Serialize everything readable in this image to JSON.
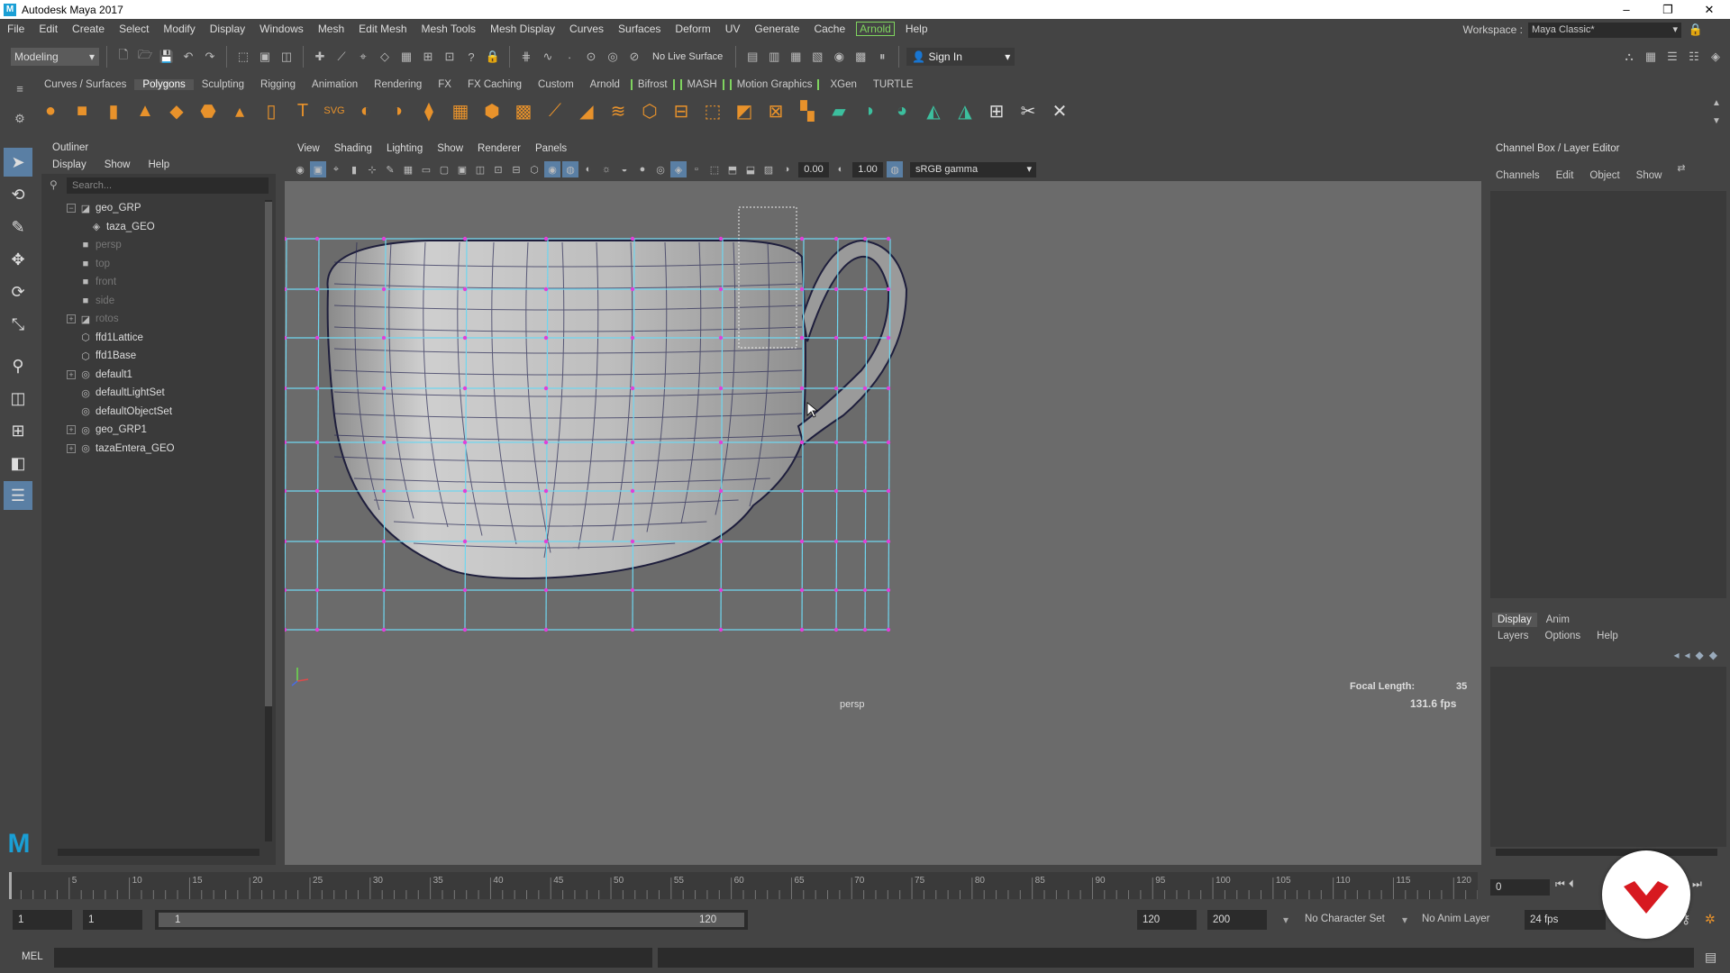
{
  "window": {
    "title": "Autodesk Maya 2017",
    "controls": [
      "–",
      "❐",
      "✕"
    ]
  },
  "menubar": {
    "items": [
      "File",
      "Edit",
      "Create",
      "Select",
      "Modify",
      "Display",
      "Windows",
      "Mesh",
      "Edit Mesh",
      "Mesh Tools",
      "Mesh Display",
      "Curves",
      "Surfaces",
      "Deform",
      "UV",
      "Generate",
      "Cache",
      "Arnold",
      "Help"
    ],
    "workspace_label": "Workspace :",
    "workspace_value": "Maya Classic*"
  },
  "statusline": {
    "mode": "Modeling",
    "live_surface": "No Live Surface",
    "sign_in": "Sign In"
  },
  "shelf": {
    "tabs": [
      "Curves / Surfaces",
      "Polygons",
      "Sculpting",
      "Rigging",
      "Animation",
      "Rendering",
      "FX",
      "FX Caching",
      "Custom",
      "Arnold",
      "Bifrost",
      "MASH",
      "Motion Graphics",
      "XGen",
      "TURTLE"
    ],
    "active_tab": "Polygons"
  },
  "outliner": {
    "title": "Outliner",
    "menu": [
      "Display",
      "Show",
      "Help"
    ],
    "search_placeholder": "Search...",
    "items": [
      {
        "label": "geo_GRP",
        "expander": "−",
        "indent": 0,
        "dim": false,
        "icon": "group-icon"
      },
      {
        "label": "taza_GEO",
        "expander": "",
        "indent": 1,
        "dim": false,
        "icon": "mesh-icon"
      },
      {
        "label": "persp",
        "expander": "",
        "indent": 0,
        "dim": true,
        "icon": "camera-icon"
      },
      {
        "label": "top",
        "expander": "",
        "indent": 0,
        "dim": true,
        "icon": "camera-icon"
      },
      {
        "label": "front",
        "expander": "",
        "indent": 0,
        "dim": true,
        "icon": "camera-icon"
      },
      {
        "label": "side",
        "expander": "",
        "indent": 0,
        "dim": true,
        "icon": "camera-icon"
      },
      {
        "label": "rotos",
        "expander": "+",
        "indent": 0,
        "dim": true,
        "icon": "group-icon"
      },
      {
        "label": "ffd1Lattice",
        "expander": "",
        "indent": 0,
        "dim": false,
        "icon": "lattice-icon"
      },
      {
        "label": "ffd1Base",
        "expander": "",
        "indent": 0,
        "dim": false,
        "icon": "lattice-icon"
      },
      {
        "label": "default1",
        "expander": "+",
        "indent": 0,
        "dim": false,
        "icon": "set-icon"
      },
      {
        "label": "defaultLightSet",
        "expander": "",
        "indent": 0,
        "dim": false,
        "icon": "set-icon"
      },
      {
        "label": "defaultObjectSet",
        "expander": "",
        "indent": 0,
        "dim": false,
        "icon": "set-icon"
      },
      {
        "label": "geo_GRP1",
        "expander": "+",
        "indent": 0,
        "dim": false,
        "icon": "set-icon"
      },
      {
        "label": "tazaEntera_GEO",
        "expander": "+",
        "indent": 0,
        "dim": false,
        "icon": "set-icon"
      }
    ]
  },
  "viewport": {
    "menu": [
      "View",
      "Shading",
      "Lighting",
      "Show",
      "Renderer",
      "Panels"
    ],
    "exposure": "0.00",
    "gamma": "1.00",
    "colorspace": "sRGB gamma",
    "camera": "persp",
    "focal_length_label": "Focal Length:",
    "focal_length": "35",
    "fps": "131.6 fps"
  },
  "channelbox": {
    "title": "Channel Box / Layer Editor",
    "menu": [
      "Channels",
      "Edit",
      "Object",
      "Show"
    ]
  },
  "layers": {
    "tabs": [
      "Display",
      "Anim"
    ],
    "menu": [
      "Layers",
      "Options",
      "Help"
    ]
  },
  "timeline": {
    "ticks": [
      "5",
      "10",
      "15",
      "20",
      "25",
      "30",
      "35",
      "40",
      "45",
      "50",
      "55",
      "60",
      "65",
      "70",
      "75",
      "80",
      "85",
      "90",
      "95",
      "100",
      "105",
      "110",
      "115",
      "120"
    ],
    "current_frame": "0"
  },
  "range": {
    "start": "1",
    "playback_start": "1",
    "slider_start": "1",
    "slider_end": "120",
    "playback_end": "120",
    "end": "200",
    "character_set": "No Character Set",
    "anim_layer": "No Anim Layer",
    "fps": "24 fps"
  },
  "cmdline": {
    "label": "MEL"
  },
  "colors": {
    "accent": "#5a7fa4",
    "lattice": "#6fd6f0",
    "points": "#e040d8",
    "arnold": "#7fd45f",
    "brand_red": "#d71920"
  }
}
